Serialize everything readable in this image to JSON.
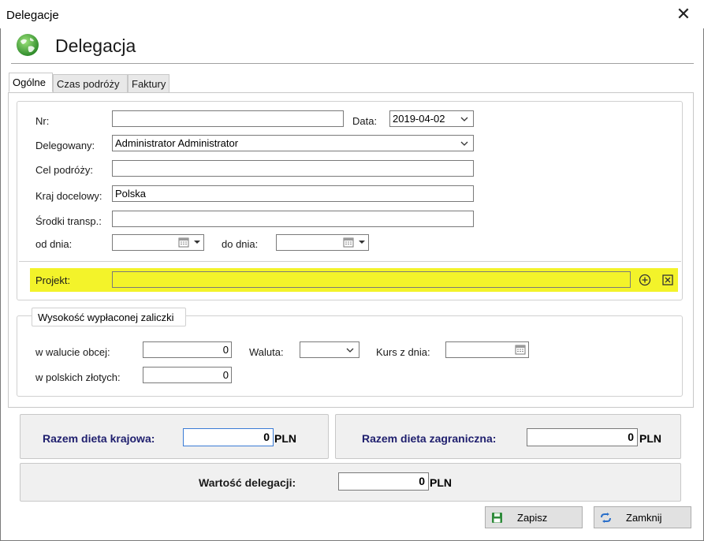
{
  "window": {
    "title": "Delegacje",
    "close_glyph": "✕"
  },
  "header": {
    "title": "Delegacja",
    "icon": "globe-icon"
  },
  "tabs": [
    {
      "label": "Ogólne"
    },
    {
      "label": "Czas podróży"
    },
    {
      "label": "Faktury"
    }
  ],
  "general": {
    "nr": {
      "label": "Nr:",
      "value": ""
    },
    "data": {
      "label": "Data:",
      "value": "2019-04-02"
    },
    "delegowany": {
      "label": "Delegowany:",
      "value": "Administrator Administrator"
    },
    "cel": {
      "label": "Cel podróży:",
      "value": ""
    },
    "kraj": {
      "label": "Kraj docelowy:",
      "value": "Polska"
    },
    "srodki": {
      "label": "Środki transp.:",
      "value": ""
    },
    "od_dnia": {
      "label": "od dnia:",
      "value": ""
    },
    "do_dnia": {
      "label": "do dnia:",
      "value": ""
    },
    "projekt": {
      "label": "Projekt:",
      "value": ""
    }
  },
  "advance": {
    "legend": "Wysokość wypłaconej zaliczki",
    "foreign": {
      "label": "w walucie obcej:",
      "value": "0"
    },
    "waluta": {
      "label": "Waluta:",
      "value": ""
    },
    "kurs": {
      "label": "Kurs z dnia:",
      "value": ""
    },
    "pln": {
      "label": "w polskich złotych:",
      "value": "0"
    }
  },
  "summary": {
    "currency": "PLN",
    "krajowa": {
      "label": "Razem dieta krajowa:",
      "value": "0"
    },
    "zagraniczna": {
      "label": "Razem dieta zagraniczna:",
      "value": "0"
    },
    "wartosc": {
      "label": "Wartość delegacji:",
      "value": "0"
    }
  },
  "buttons": {
    "save": "Zapisz",
    "close": "Zamknij"
  },
  "colors": {
    "highlight": "#f3f32a",
    "summary_label": "#1f1f6e"
  }
}
